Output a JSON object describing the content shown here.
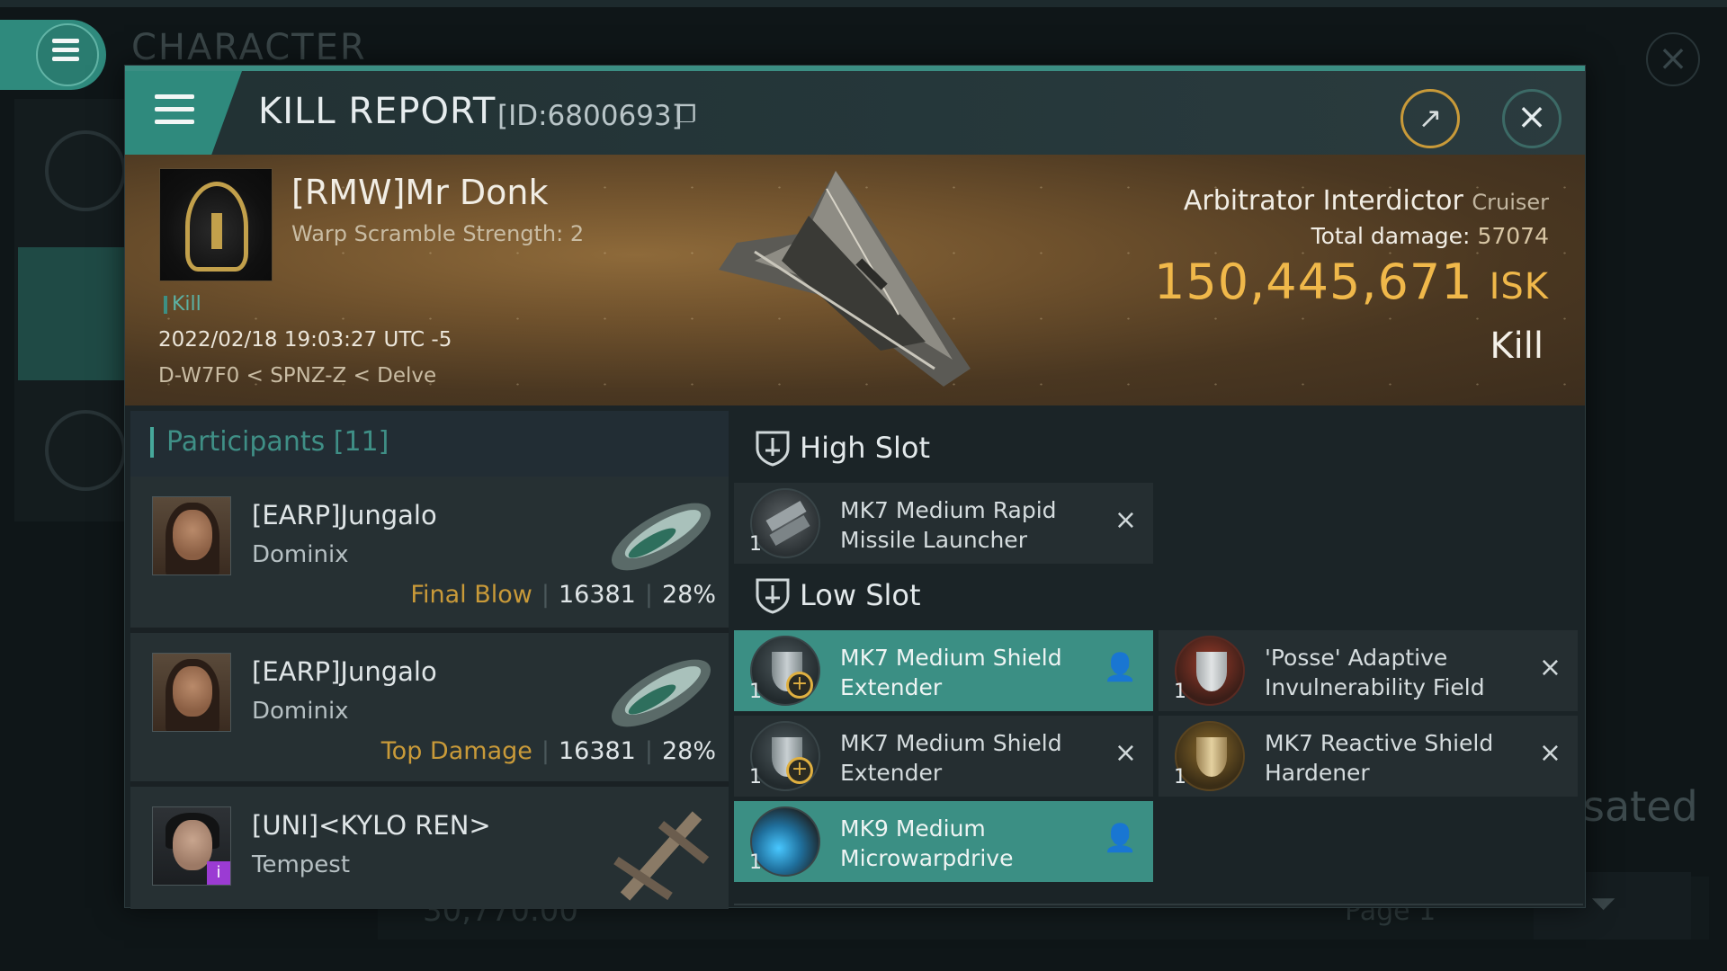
{
  "background": {
    "title": "CHARACTER",
    "side_text": "sated",
    "bottom_value": "30,770.00",
    "page_label": "Page 1"
  },
  "header": {
    "title": "KILL REPORT",
    "id_label": "[ID:6800693]",
    "copy_icon": "copy-icon",
    "share_icon": "share-icon",
    "close_icon": "close-icon"
  },
  "victim": {
    "name": "[RMW]Mr Donk",
    "warp_scramble": "Warp Scramble Strength: 2",
    "tag": "Kill",
    "datetime": "2022/02/18 19:03:27 UTC -5",
    "location": "D-W7F0 < SPNZ-Z < Delve",
    "ship": "Arbitrator Interdictor",
    "ship_class": "Cruiser",
    "damage_label": "Total damage:",
    "damage_value": "57074",
    "isk_value": "150,445,671",
    "isk_unit": "ISK",
    "result": "Kill"
  },
  "participants": {
    "header": "Participants [11]",
    "items": [
      {
        "name": "[EARP]Jungalo",
        "ship": "Dominix",
        "role": "Final Blow",
        "damage": "16381",
        "percent": "28%"
      },
      {
        "name": "[EARP]Jungalo",
        "ship": "Dominix",
        "role": "Top Damage",
        "damage": "16381",
        "percent": "28%"
      },
      {
        "name": "[UNI]<KYLO REN>",
        "ship": "Tempest",
        "badge": "i"
      }
    ]
  },
  "fitting": {
    "high_slot_label": "High Slot",
    "low_slot_label": "Low Slot",
    "high": [
      {
        "name": "MK7 Medium Rapid Missile Launcher",
        "qty": "1",
        "action": "×"
      }
    ],
    "low": [
      {
        "name": "MK7 Medium Shield Extender",
        "qty": "1",
        "action": "person-icon"
      },
      {
        "name": "'Posse' Adaptive Invulnerability Field",
        "qty": "1",
        "action": "×"
      },
      {
        "name": "MK7 Medium Shield Extender",
        "qty": "1",
        "action": "×"
      },
      {
        "name": "MK7 Reactive Shield Hardener",
        "qty": "1",
        "action": "×"
      },
      {
        "name": "MK9 Medium Microwarpdrive",
        "qty": "1",
        "action": "person-icon"
      }
    ]
  }
}
